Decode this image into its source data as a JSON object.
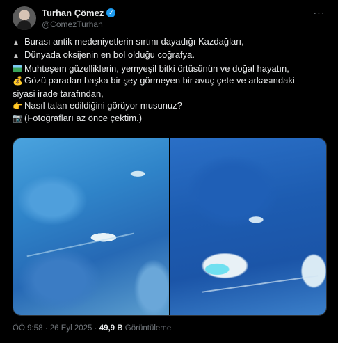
{
  "author": {
    "name": "Turhan Çömez",
    "handle": "@ComezTurhan",
    "verified_icon": "check-badge-icon",
    "more_label": "···"
  },
  "tweet": {
    "lines": [
      {
        "icon": "mountain-icon",
        "glyph": "▲",
        "text": "Burası antik medeniyetlerin sırtını dayadığı Kazdağları,"
      },
      {
        "icon": "mountain-icon",
        "glyph": "▲",
        "text": "Dünyada oksijenin en bol olduğu coğrafya."
      },
      {
        "icon": "national-park-icon",
        "glyph": "",
        "text": "Muhteşem güzelliklerin, yemyeşil bitki örtüsünün ve doğal hayatın,"
      },
      {
        "icon": "money-bag-icon",
        "glyph": "💰",
        "text": "Gözü paradan başka bir şey görmeyen bir avuç çete ve arkasındaki"
      },
      {
        "icon": "",
        "glyph": "",
        "text": "siyasi irade tarafından,"
      },
      {
        "icon": "pointing-hand-icon",
        "glyph": "👉",
        "text": "Nasıl talan edildiğini görüyor musunuz?"
      },
      {
        "icon": "camera-icon",
        "glyph": "📷",
        "text": "(Fotoğrafları az önce çektim.)"
      }
    ]
  },
  "media": {
    "photos": [
      "aerial-photo-1",
      "aerial-photo-2"
    ]
  },
  "meta": {
    "time": "ÖÖ 9:58",
    "separator": " · ",
    "date": "26 Eyl 2025",
    "views_count": "49,9 B",
    "views_label": "Görüntüleme"
  }
}
